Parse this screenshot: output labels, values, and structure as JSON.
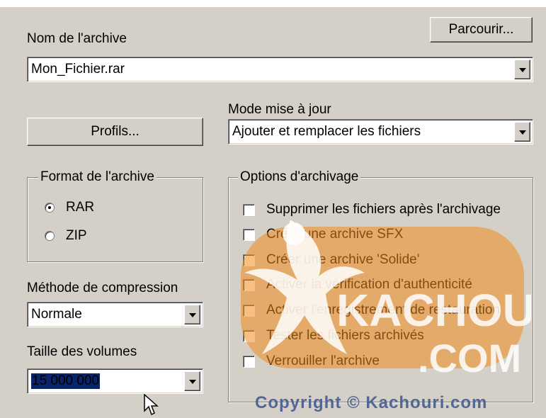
{
  "archive_name": {
    "label": "Nom de l'archive",
    "value": "Mon_Fichier.rar",
    "browse_label": "Parcourir..."
  },
  "profiles_label": "Profils...",
  "update_mode": {
    "label": "Mode mise à jour",
    "value": "Ajouter et remplacer les fichiers"
  },
  "format": {
    "title": "Format de l'archive",
    "options": [
      "RAR",
      "ZIP"
    ],
    "selected": "RAR"
  },
  "compression": {
    "label": "Méthode de compression",
    "value": "Normale"
  },
  "volumes": {
    "label": "Taille des volumes",
    "value": "15 000 000"
  },
  "options": {
    "title": "Options d'archivage",
    "items": [
      {
        "label": "Supprimer les fichiers après l'archivage",
        "checked": false
      },
      {
        "label": "Créer une archive SFX",
        "checked": false
      },
      {
        "label": "Créer une archive 'Solide'",
        "checked": false
      },
      {
        "label": "Activer la vérification d'authenticité",
        "checked": false
      },
      {
        "label": "Activer l'enregistrement de restauration",
        "checked": false
      },
      {
        "label": "Tester les fichiers archivés",
        "checked": false
      },
      {
        "label": "Verrouiller l'archive",
        "checked": false
      }
    ]
  },
  "watermark": {
    "logo_text": "KACHOURI",
    "logo_sub": ".COM",
    "copyright": "Copyright © Kachouri.com"
  },
  "colors": {
    "dialog_bg": "#d4d0c8",
    "selection": "#0a246a",
    "watermark": "#f08a1c"
  }
}
